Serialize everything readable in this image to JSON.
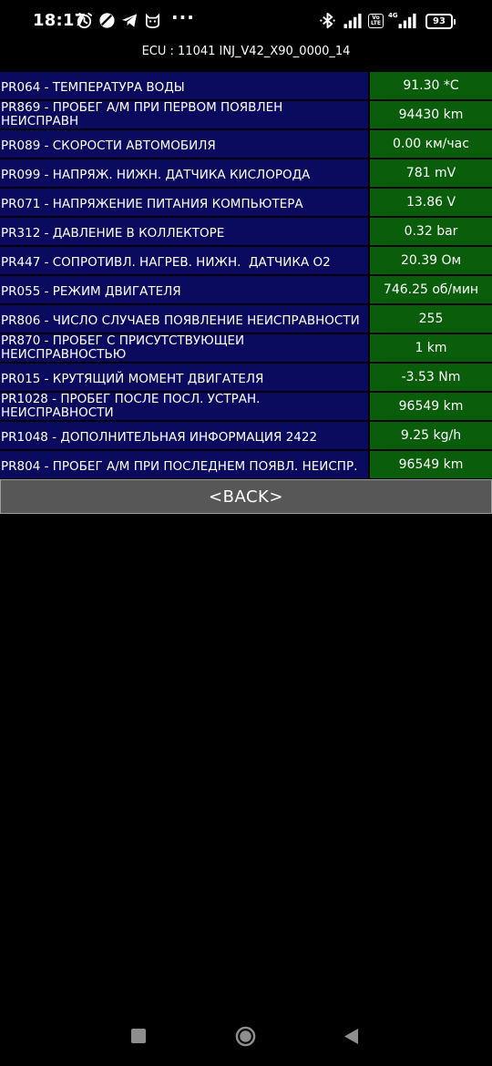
{
  "status_bar": {
    "time": "18:17",
    "dots": "···",
    "volte": "Vo LTE",
    "network": "4G",
    "battery": "93",
    "icons": [
      "alarm-icon",
      "blocked-icon",
      "telegram-icon",
      "cat-app-icon",
      "bluetooth-icon",
      "signal-icon",
      "signal-icon"
    ]
  },
  "header": {
    "ecu": "ECU : 11041  INJ_V42_X90_0000_14"
  },
  "parameters": [
    {
      "name": "PR064 - ТЕМПЕРАТУРА ВОДЫ",
      "value": "91.30 *C"
    },
    {
      "name": "PR869 - ПРОБЕГ А/М ПРИ ПЕРВОМ ПОЯВЛЕН\nНЕИСПРАВН",
      "value": "94430 km"
    },
    {
      "name": "PR089 - СКОРОСТИ АВТОМОБИЛЯ",
      "value": "0.00 км/час"
    },
    {
      "name": "PR099 - НАПРЯЖ. НИЖН. ДАТЧИКА КИСЛОРОДА",
      "value": "781 mV"
    },
    {
      "name": "PR071 - НАПРЯЖЕНИЕ ПИТАНИЯ КОМПЬЮТЕРА",
      "value": "13.86 V"
    },
    {
      "name": "PR312 - ДАВЛЕНИЕ В КОЛЛЕКТОРЕ",
      "value": "0.32 bar"
    },
    {
      "name": "PR447 - СОПРОТИВЛ. НАГРЕВ. НИЖН.  ДАТЧИКА О2",
      "value": "20.39 Ом"
    },
    {
      "name": "PR055 - РЕЖИМ ДВИГАТЕЛЯ",
      "value": "746.25 об/мин"
    },
    {
      "name": "PR806 - ЧИСЛО СЛУЧАЕВ ПОЯВЛЕНИЕ НЕИСПРАВНОСТИ",
      "value": "255"
    },
    {
      "name": "PR870 - ПРОБЕГ С ПРИСУТСТВУЮЩЕЙ\nНЕИСПРАВНОСТЬЮ",
      "value": "1 km"
    },
    {
      "name": "PR015 - КРУТЯЩИЙ МОМЕНТ ДВИГАТЕЛЯ",
      "value": "-3.53 Nm"
    },
    {
      "name": "PR1028 - ПРОБЕГ ПОСЛЕ ПОСЛ. УСТРАН.\nНЕИСПРАВНОСТИ",
      "value": "96549 km"
    },
    {
      "name": "PR1048 - ДОПОЛНИТЕЛЬНАЯ ИНФОРМАЦИЯ 2422",
      "value": "9.25 kg/h"
    },
    {
      "name": "PR804 - ПРОБЕГ А/М ПРИ ПОСЛЕДНЕМ ПОЯВЛ. НЕИСПР.",
      "value": "96549 km"
    }
  ],
  "back_button": {
    "label": "<BACK>"
  },
  "nav_bar": {
    "icons": [
      "recent-apps-icon",
      "home-icon",
      "back-triangle-icon"
    ]
  },
  "colors": {
    "name_cell_bg": "#0a0a5e",
    "value_cell_bg": "#0a5d0a",
    "button_bg": "#575757",
    "background": "#000000"
  }
}
